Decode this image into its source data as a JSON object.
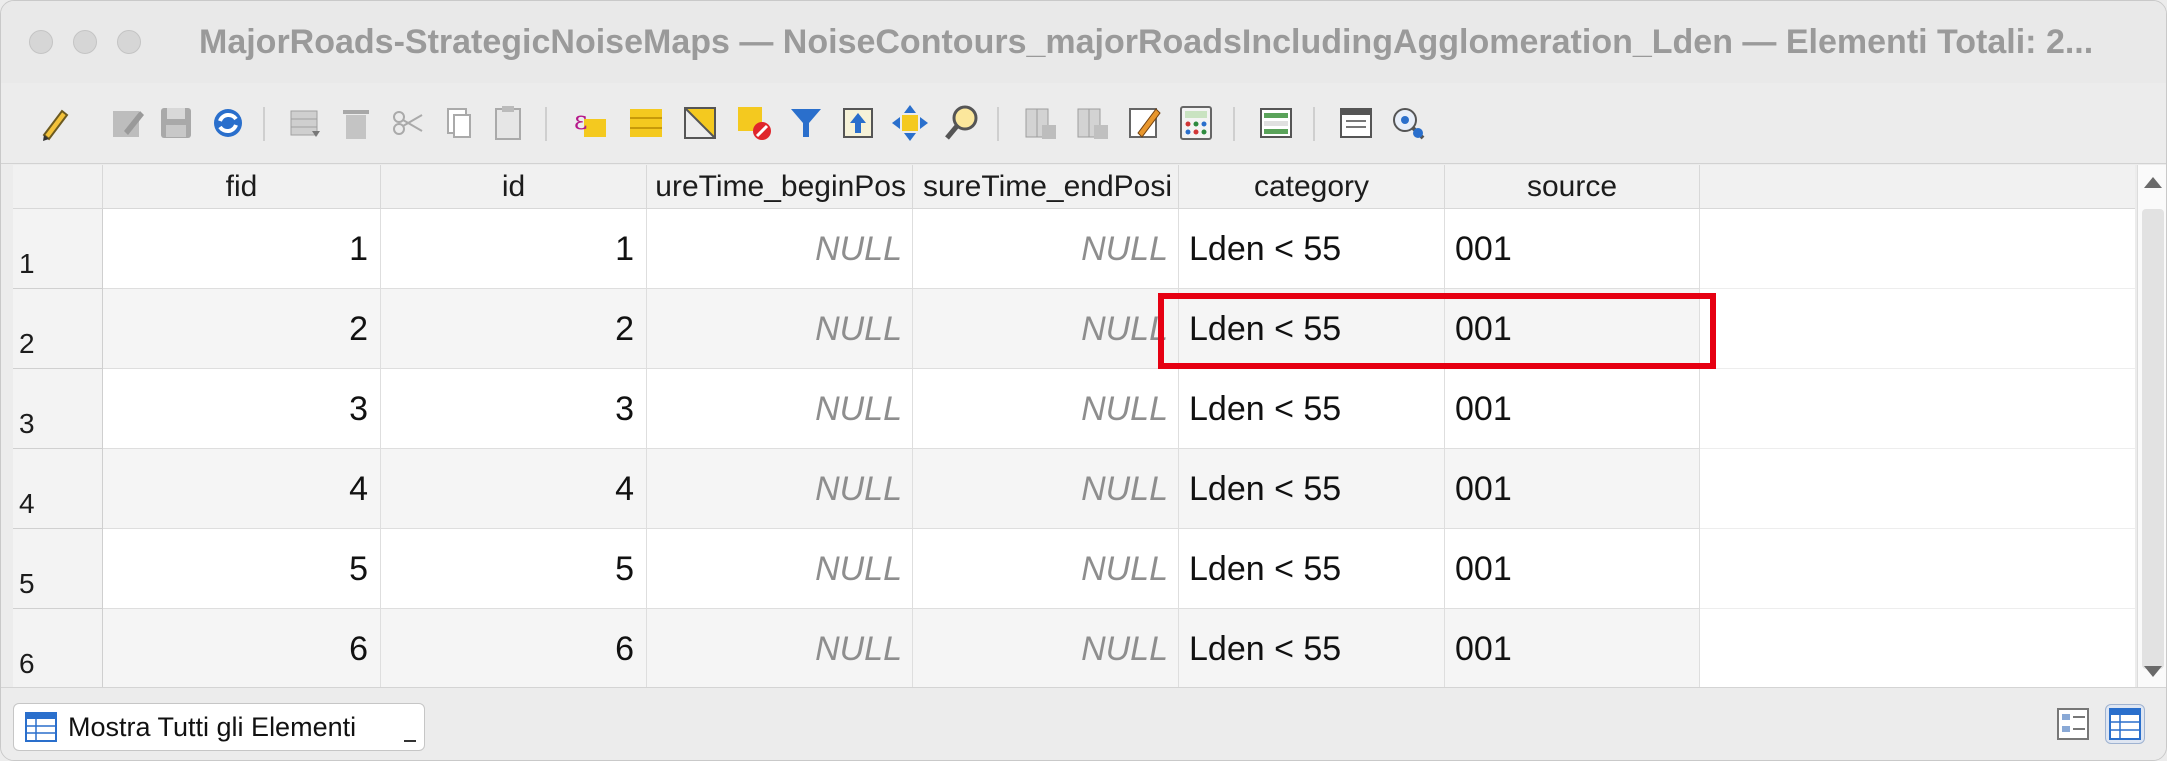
{
  "window": {
    "title": "MajorRoads-StrategicNoiseMaps — NoiseContours_majorRoadsIncludingAgglomeration_Lden — Elementi Totali: 2..."
  },
  "toolbar": {
    "icons": [
      "pencil-icon",
      "multi-edit-icon",
      "save-icon",
      "reload-icon",
      "add-feature-icon",
      "delete-icon",
      "cut-icon",
      "copy-icon",
      "paste-icon",
      "expression-select-icon",
      "select-all-icon",
      "invert-selection-icon",
      "deselect-icon",
      "filter-icon",
      "move-top-icon",
      "pan-to-selection-icon",
      "zoom-to-selection-icon",
      "new-field-icon",
      "delete-field-icon",
      "field-calculator-icon",
      "conditional-format-icon",
      "dock-icon",
      "actions-icon",
      "organize-columns-icon"
    ]
  },
  "table": {
    "columns": [
      "fid",
      "id",
      "ureTime_beginPos",
      "sureTime_endPosi",
      "category",
      "source"
    ],
    "rows": [
      {
        "row_number": "1",
        "fid": "1",
        "id": "1",
        "begin": "NULL",
        "end": "NULL",
        "category": "Lden < 55",
        "source": "001"
      },
      {
        "row_number": "2",
        "fid": "2",
        "id": "2",
        "begin": "NULL",
        "end": "NULL",
        "category": "Lden < 55",
        "source": "001"
      },
      {
        "row_number": "3",
        "fid": "3",
        "id": "3",
        "begin": "NULL",
        "end": "NULL",
        "category": "Lden < 55",
        "source": "001"
      },
      {
        "row_number": "4",
        "fid": "4",
        "id": "4",
        "begin": "NULL",
        "end": "NULL",
        "category": "Lden < 55",
        "source": "001"
      },
      {
        "row_number": "5",
        "fid": "5",
        "id": "5",
        "begin": "NULL",
        "end": "NULL",
        "category": "Lden < 55",
        "source": "001"
      },
      {
        "row_number": "6",
        "fid": "6",
        "id": "6",
        "begin": "NULL",
        "end": "NULL",
        "category": "Lden < 55",
        "source": "001"
      }
    ],
    "highlight_color": "#e60012"
  },
  "bottom": {
    "show_all_label": "Mostra Tutti gli Elementi"
  }
}
